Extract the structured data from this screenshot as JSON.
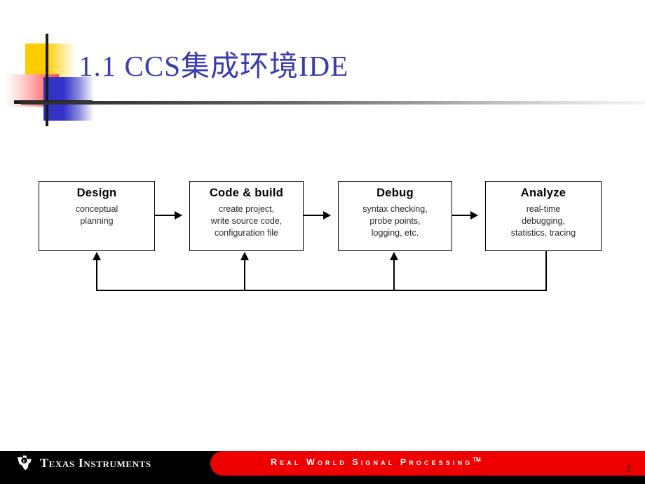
{
  "slide": {
    "title": "1.1  CCS集成环境IDE",
    "page_number": "2",
    "accent_color": "#3B3BAF",
    "deco": {
      "yellow_color": "#FFCC00",
      "blue_color": "#3333CC",
      "pink_color": "#FF4444",
      "cross_color": "#1A1A1A"
    }
  },
  "flowchart": {
    "boxes": [
      {
        "id": "design",
        "title": "Design",
        "lines": [
          "conceptual",
          "planning"
        ]
      },
      {
        "id": "code-build",
        "title": "Code & build",
        "lines": [
          "create project,",
          "write source code,",
          "configuration file"
        ]
      },
      {
        "id": "debug",
        "title": "Debug",
        "lines": [
          "syntax checking,",
          "probe points,",
          "logging, etc."
        ]
      },
      {
        "id": "analyze",
        "title": "Analyze",
        "lines": [
          "real-time",
          "debugging,",
          "statistics, tracing"
        ]
      }
    ]
  },
  "footer": {
    "brand": "Texas Instruments",
    "tagline": "Real World Signal Processing",
    "trademark": "TM",
    "bar_color": "#000000",
    "accent_color": "#EE0000"
  }
}
